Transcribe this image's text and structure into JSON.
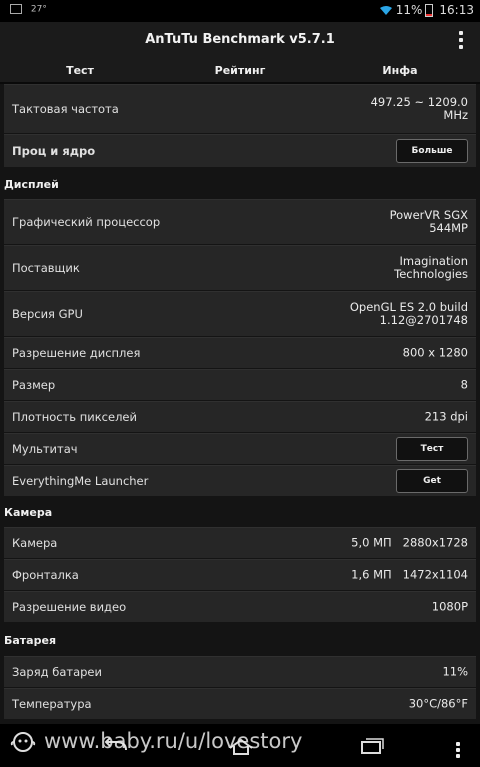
{
  "status_bar": {
    "temperature": "27°",
    "battery": "11%",
    "time": "16:13"
  },
  "app": {
    "title": "AnTuTu Benchmark v5.7.1"
  },
  "tabs": [
    {
      "label": "Тест"
    },
    {
      "label": "Рейтинг"
    },
    {
      "label": "Инфа"
    }
  ],
  "cpu": {
    "clock_label": "Тактовая частота",
    "clock_value_line1": "497.25 ~ 1209.0",
    "clock_value_line2": "MHz",
    "cores_label": "Проц и ядро",
    "cores_button": "Больше"
  },
  "display": {
    "header": "Дисплей",
    "rows": [
      {
        "label": "Графический процессор",
        "value_line1": "PowerVR SGX",
        "value_line2": "544MP"
      },
      {
        "label": "Поставщик",
        "value_line1": "Imagination",
        "value_line2": "Technologies"
      },
      {
        "label": "Версия GPU",
        "value_line1": "OpenGL ES 2.0 build",
        "value_line2": "1.12@2701748"
      },
      {
        "label": "Разрешение дисплея",
        "value": "800 x 1280"
      },
      {
        "label": "Размер",
        "value": "8"
      },
      {
        "label": "Плотность пикселей",
        "value": "213 dpi"
      }
    ],
    "multitouch_label": "Мультитач",
    "multitouch_button": "Тест",
    "launcher_label": "EverythingMe Launcher",
    "launcher_button": "Get"
  },
  "camera": {
    "header": "Камера",
    "rows": [
      {
        "label": "Камера",
        "mp": "5,0 МП",
        "resolution": "2880x1728"
      },
      {
        "label": "Фронталка",
        "mp": "1,6 МП",
        "resolution": "1472x1104"
      },
      {
        "label": "Разрешение видео",
        "value": "1080P"
      }
    ]
  },
  "battery": {
    "header": "Батарея",
    "rows": [
      {
        "label": "Заряд батареи",
        "value": "11%"
      },
      {
        "label": "Температура",
        "value": "30°C/86°F"
      }
    ]
  },
  "watermark": {
    "text": "www.baby.ru/u/lovestory"
  }
}
